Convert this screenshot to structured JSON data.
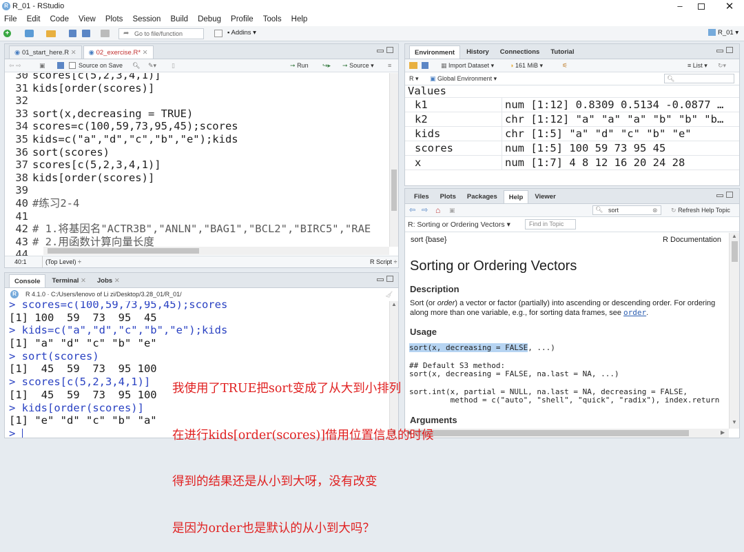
{
  "window": {
    "title": "R_01 - RStudio",
    "project": "R_01"
  },
  "menu": [
    "File",
    "Edit",
    "Code",
    "View",
    "Plots",
    "Session",
    "Build",
    "Debug",
    "Profile",
    "Tools",
    "Help"
  ],
  "toolbar": {
    "goto_placeholder": "Go to file/function",
    "addins": "Addins"
  },
  "editor": {
    "tabs": [
      "01_start_here.R",
      "02_exercise.R*"
    ],
    "source_on_save": "Source on Save",
    "run": "Run",
    "source": "Source",
    "lines": [
      {
        "n": "30",
        "t": "scores[c(5,2,3,4,1)]"
      },
      {
        "n": "31",
        "t": "kids[order(scores)]"
      },
      {
        "n": "32",
        "t": ""
      },
      {
        "n": "33",
        "t": "sort(x,decreasing = TRUE)"
      },
      {
        "n": "34",
        "t": "scores=c(100,59,73,95,45);scores"
      },
      {
        "n": "35",
        "t": "kids=c(\"a\",\"d\",\"c\",\"b\",\"e\");kids"
      },
      {
        "n": "36",
        "t": "sort(scores)"
      },
      {
        "n": "37",
        "t": "scores[c(5,2,3,4,1)]"
      },
      {
        "n": "38",
        "t": "kids[order(scores)]"
      },
      {
        "n": "39",
        "t": ""
      },
      {
        "n": "40",
        "t": "#练习2-4"
      },
      {
        "n": "41",
        "t": ""
      },
      {
        "n": "42",
        "t": "# 1.将基因名\"ACTR3B\",\"ANLN\",\"BAG1\",\"BCL2\",\"BIRC5\",\"RAE"
      },
      {
        "n": "43",
        "t": "# 2.用函数计算向量长度"
      },
      {
        "n": "44",
        "t": ""
      }
    ],
    "status_pos": "40:1",
    "status_scope": "(Top Level) ÷",
    "status_type": "R Script ÷"
  },
  "console": {
    "tabs": [
      "Console",
      "Terminal",
      "Jobs"
    ],
    "path": "R 4.1.0 · C:/Users/lenovo of Li zi/Desktop/3.28_01/R_01/",
    "lines": [
      {
        "p": "> ",
        "c": "scores=c(100,59,73,95,45);scores",
        "o": ""
      },
      {
        "p": "",
        "c": "",
        "o": "[1] 100  59  73  95  45"
      },
      {
        "p": "> ",
        "c": "kids=c(\"a\",\"d\",\"c\",\"b\",\"e\");kids",
        "o": ""
      },
      {
        "p": "",
        "c": "",
        "o": "[1] \"a\" \"d\" \"c\" \"b\" \"e\""
      },
      {
        "p": "> ",
        "c": "sort(scores)",
        "o": ""
      },
      {
        "p": "",
        "c": "",
        "o": "[1]  45  59  73  95 100"
      },
      {
        "p": "> ",
        "c": "scores[c(5,2,3,4,1)]",
        "o": ""
      },
      {
        "p": "",
        "c": "",
        "o": "[1]  45  59  73  95 100"
      },
      {
        "p": "> ",
        "c": "kids[order(scores)]",
        "o": ""
      },
      {
        "p": "",
        "c": "",
        "o": "[1] \"e\" \"d\" \"c\" \"b\" \"a\""
      },
      {
        "p": "> ",
        "c": "",
        "o": ""
      }
    ]
  },
  "environment": {
    "tabs": [
      "Environment",
      "History",
      "Connections",
      "Tutorial"
    ],
    "import": "Import Dataset",
    "memory": "161 MiB",
    "list": "List",
    "lang": "R",
    "scope": "Global Environment",
    "section": "Values",
    "rows": [
      {
        "k": "k1",
        "v": "num [1:12] 0.8309 0.5134 -0.0877 …"
      },
      {
        "k": "k2",
        "v": "chr [1:12] \"a\" \"a\" \"a\" \"b\" \"b\" \"b…"
      },
      {
        "k": "kids",
        "v": "chr [1:5] \"a\" \"d\" \"c\" \"b\" \"e\""
      },
      {
        "k": "scores",
        "v": "num [1:5] 100 59 73 95 45"
      },
      {
        "k": "x",
        "v": "num [1:7] 4 8 12 16 20 24 28"
      }
    ]
  },
  "help": {
    "tabs": [
      "Files",
      "Plots",
      "Packages",
      "Help",
      "Viewer"
    ],
    "search": "sort",
    "refresh": "Refresh Help Topic",
    "topic": "R: Sorting or Ordering Vectors",
    "find": "Find in Topic",
    "pkg": "sort {base}",
    "doc": "R Documentation",
    "title": "Sorting or Ordering Vectors",
    "desc_h": "Description",
    "desc_1": "Sort (or ",
    "desc_order": "order",
    "desc_2": ") a vector or factor (partially) into ascending or descending order. For ordering along more than one variable, e.g., for sorting data frames, see ",
    "desc_link": "order",
    "desc_3": ".",
    "usage_h": "Usage",
    "usage_1": "sort(x, decreasing = FALSE",
    "usage_1b": ", ...)",
    "usage_2": "## Default S3 method:",
    "usage_3": "sort(x, decreasing = FALSE, na.last = NA, ...)",
    "usage_4": "sort.int(x, partial = NULL, na.last = NA, decreasing = FALSE,",
    "usage_5": "         method = c(\"auto\", \"shell\", \"quick\", \"radix\"), index.return",
    "args_h": "Arguments"
  },
  "annotation": [
    "我使用了TRUE把sort变成了从大到小排列",
    "在进行kids[order(scores)]借用位置信息的时候",
    "得到的结果还是从小到大呀，没有改变",
    "是因为order也是默认的从小到大吗？"
  ],
  "colors": {
    "annotation": "#e02020",
    "keyword": "#3a5fc8",
    "prompt": "#2941c2",
    "accent": "#4a90d9"
  }
}
